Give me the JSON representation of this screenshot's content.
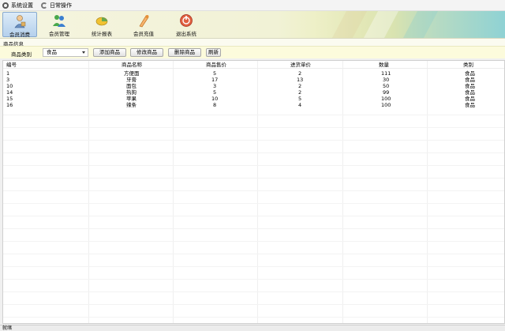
{
  "menubar": {
    "items": [
      {
        "label": "系统设置",
        "icon": "gear-icon"
      },
      {
        "label": "日常操作",
        "icon": "refresh-icon"
      }
    ]
  },
  "toolbar": {
    "buttons": [
      {
        "label": "会员消费",
        "icon": "member-consume-icon",
        "active": true
      },
      {
        "label": "会员管理",
        "icon": "member-manage-icon",
        "active": false
      },
      {
        "label": "统计报表",
        "icon": "report-icon",
        "active": false
      },
      {
        "label": "会员充值",
        "icon": "recharge-icon",
        "active": false
      },
      {
        "label": "退出系统",
        "icon": "exit-icon",
        "active": false
      }
    ]
  },
  "product_info": {
    "title": "商品信息",
    "category_label": "商品类别",
    "category_value": "食品",
    "buttons": {
      "add": "添加商品",
      "edit": "修改商品",
      "delete": "删除商品",
      "refresh": "刷新"
    }
  },
  "table": {
    "columns": [
      "编号",
      "商品名称",
      "商品售价",
      "进货单价",
      "数量",
      "类别"
    ],
    "rows": [
      [
        "1",
        "方便面",
        "5",
        "2",
        "111",
        "食品"
      ],
      [
        "3",
        "牙膏",
        "17",
        "13",
        "30",
        "食品"
      ],
      [
        "10",
        "面包",
        "3",
        "2",
        "50",
        "食品"
      ],
      [
        "14",
        "热狗",
        "5",
        "2",
        "99",
        "食品"
      ],
      [
        "15",
        "苹果",
        "10",
        "5",
        "100",
        "食品"
      ],
      [
        "16",
        "辣条",
        "8",
        "4",
        "100",
        "食品"
      ]
    ]
  },
  "statusbar": {
    "text": "就绪"
  },
  "colors": {
    "accent": "#b5d0ec",
    "toolbar_bg": "#f1f2d6",
    "filter_bg": "#fcfbdc"
  }
}
